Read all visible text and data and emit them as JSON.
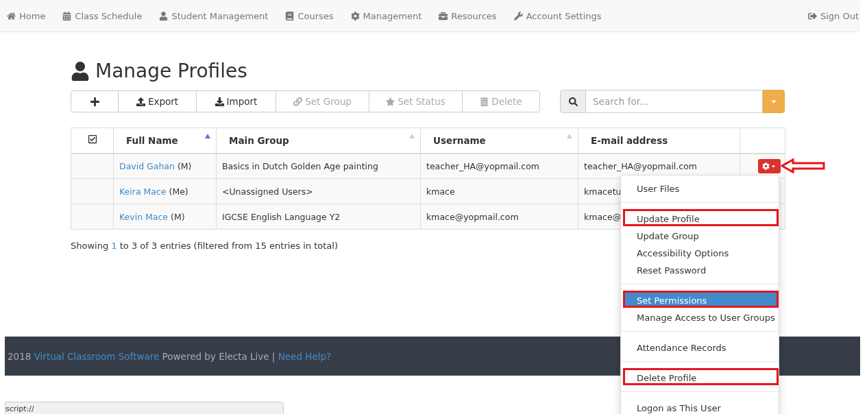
{
  "nav": {
    "items": [
      {
        "label": "Home"
      },
      {
        "label": "Class Schedule"
      },
      {
        "label": "Student Management"
      },
      {
        "label": "Courses"
      },
      {
        "label": "Management"
      },
      {
        "label": "Resources"
      },
      {
        "label": "Account Settings"
      }
    ],
    "sign_out": "Sign Out"
  },
  "page_title": "Manage Profiles",
  "toolbar": [
    {
      "disabled": false
    },
    {
      "label": "Export",
      "disabled": false
    },
    {
      "label": "Import",
      "disabled": false
    },
    {
      "label": "Set Group",
      "disabled": true
    },
    {
      "label": "Set Status",
      "disabled": true
    },
    {
      "label": "Delete",
      "disabled": true
    }
  ],
  "search": {
    "placeholder": "Search for..."
  },
  "table": {
    "columns": [
      {
        "label": "Full Name",
        "sorted": true
      },
      {
        "label": "Main Group",
        "sorted": false
      },
      {
        "label": "Username",
        "sorted": false
      },
      {
        "label": "E-mail address"
      }
    ],
    "rows": [
      {
        "name": "David Gahan",
        "suffix": "(M)",
        "group": "Basics in Dutch Golden Age painting",
        "username": "teacher_HA@yopmail.com",
        "email": "teacher_HA@yopmail.com"
      },
      {
        "name": "Keira Mace",
        "suffix": "(Me)",
        "group": "<Unassigned Users>",
        "username": "kmace",
        "email": "kmacetu"
      },
      {
        "name": "Kevin Mace",
        "suffix": "(M)",
        "group": "IGCSE English Language Y2",
        "username": "kmace@yopmail.com",
        "email": "kmace@"
      }
    ]
  },
  "summary": {
    "before": "Showing ",
    "from": "1",
    "rest": " to 3 of 3 entries (filtered from 15 entries in total)"
  },
  "row_menu": {
    "groups": [
      [
        {
          "label": "User Files",
          "selected": false,
          "annotated": false
        }
      ],
      [
        {
          "label": "Update Profile",
          "selected": false,
          "annotated": true
        },
        {
          "label": "Update Group",
          "selected": false,
          "annotated": false
        },
        {
          "label": "Accessibility Options",
          "selected": false,
          "annotated": false
        },
        {
          "label": "Reset Password",
          "selected": false,
          "annotated": false
        }
      ],
      [
        {
          "label": "Set Permissions",
          "selected": true,
          "annotated": true
        },
        {
          "label": "Manage Access to User Groups",
          "selected": false,
          "annotated": false
        }
      ],
      [
        {
          "label": "Attendance Records",
          "selected": false,
          "annotated": false
        }
      ],
      [
        {
          "label": "Delete Profile",
          "selected": false,
          "annotated": true
        }
      ],
      [
        {
          "label": "Logon as This User",
          "selected": false,
          "annotated": false
        }
      ]
    ]
  },
  "footer": {
    "year": "2018",
    "site_link": "Virtual Classroom Software",
    "middle": "Powered by Electa Live |",
    "help_link": "Need Help?"
  },
  "status_bar": "script://"
}
